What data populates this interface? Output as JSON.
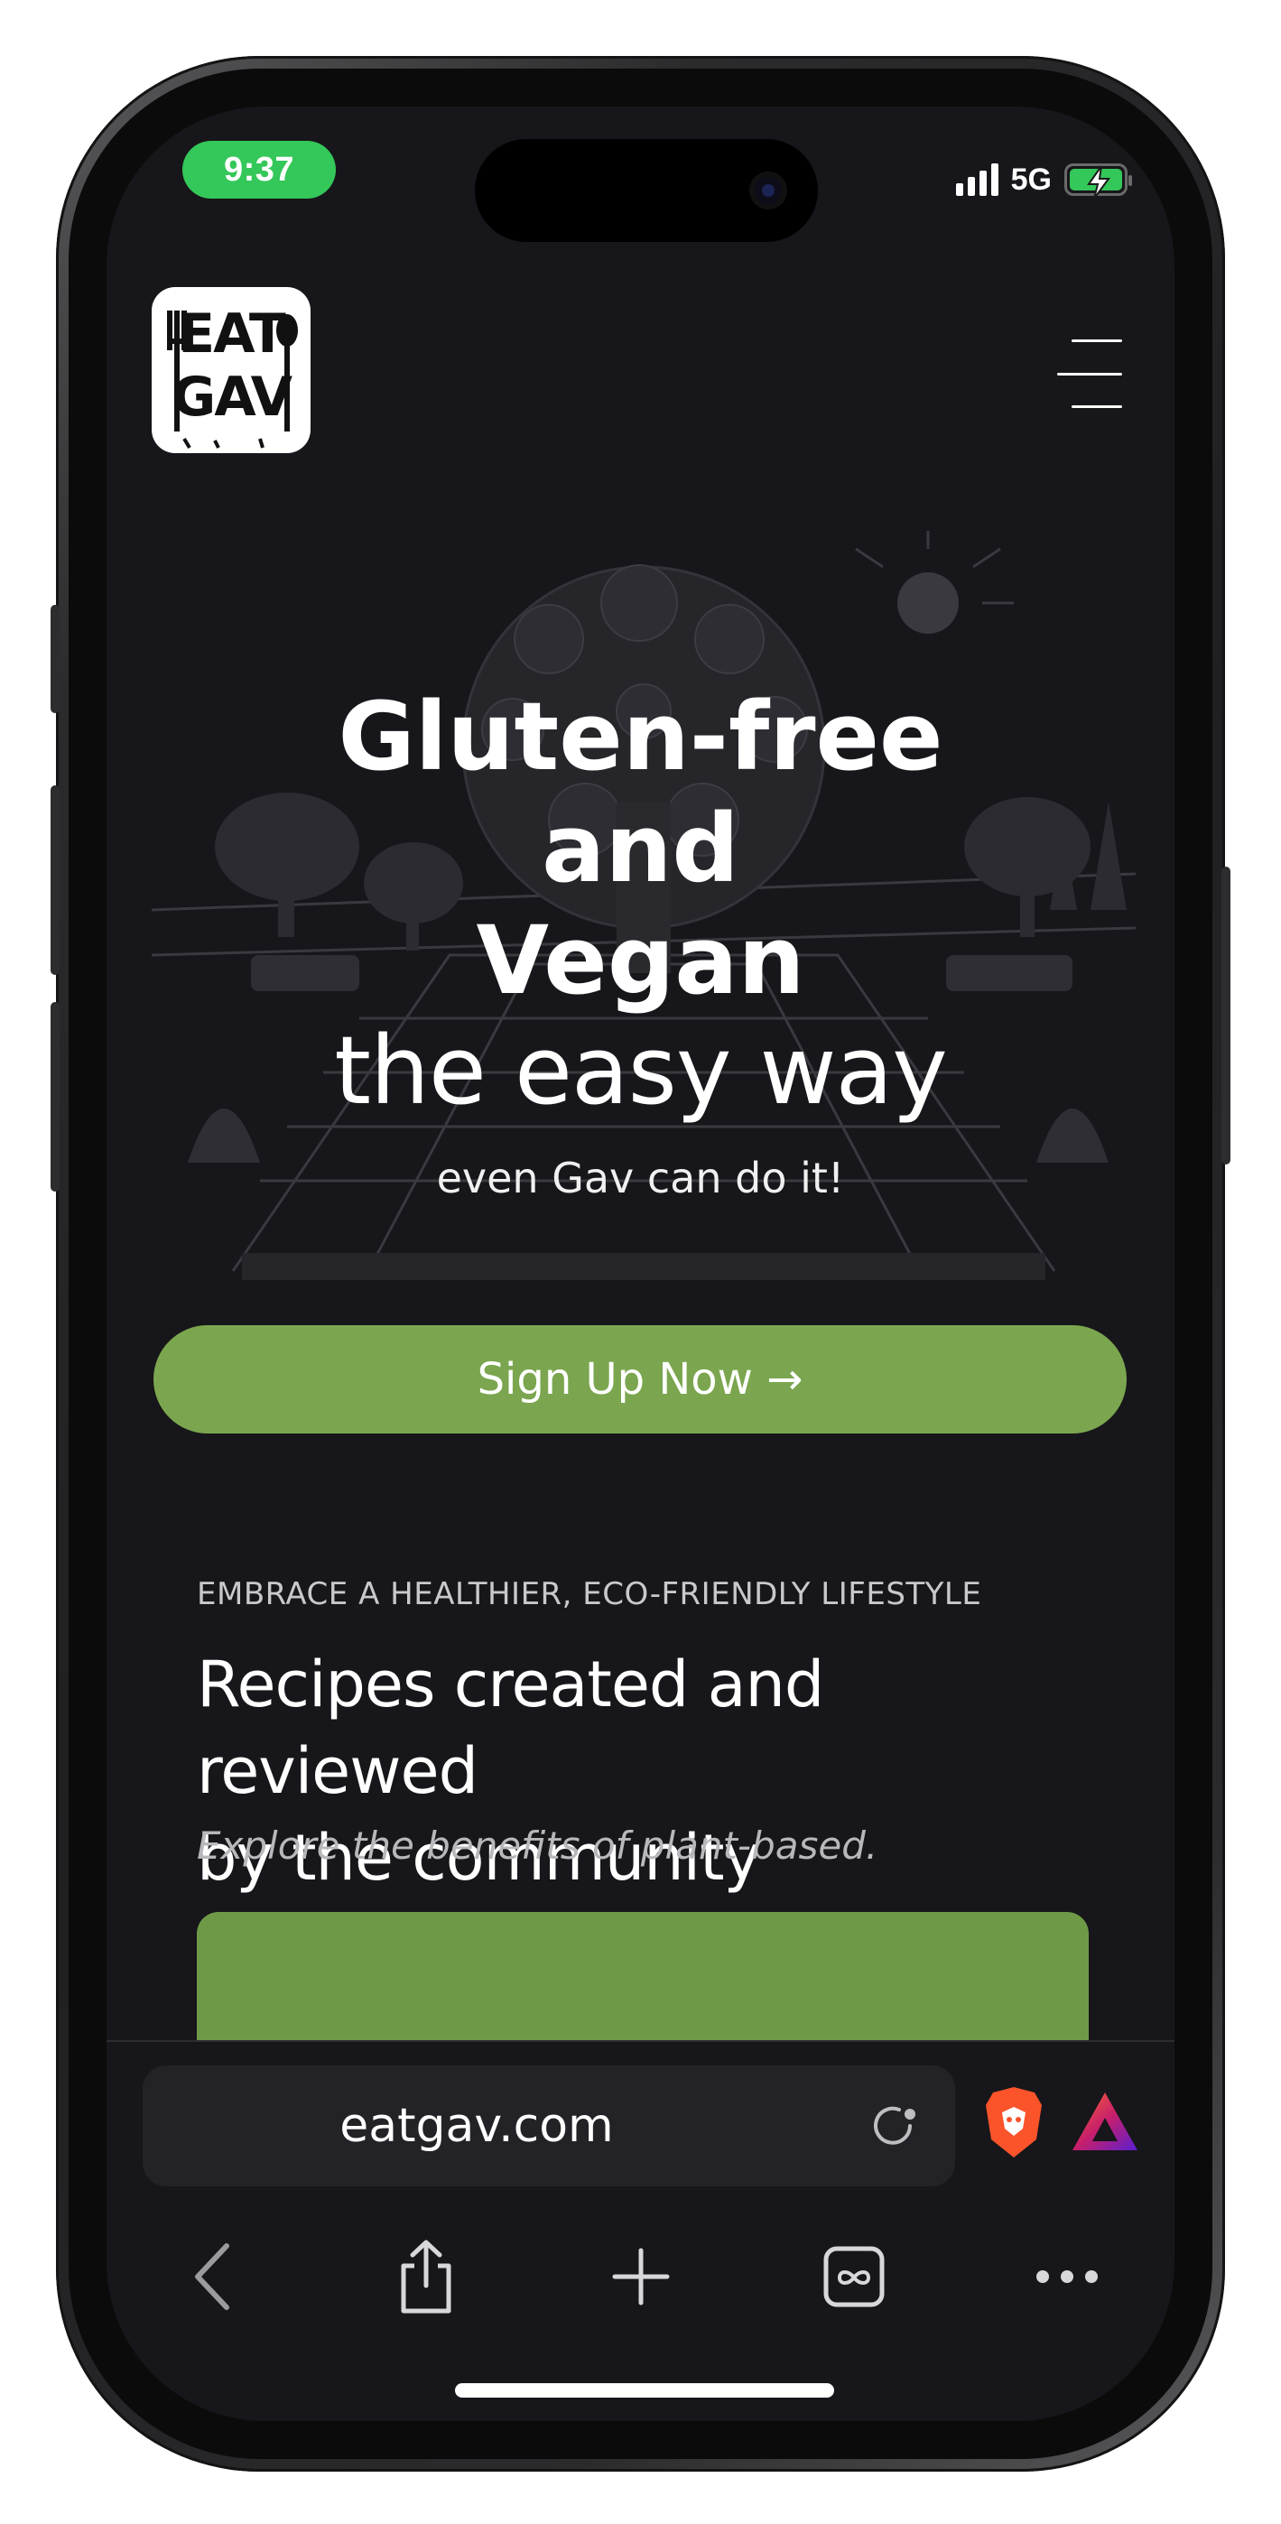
{
  "status_bar": {
    "time": "9:37",
    "network": "5G",
    "battery_state": "charging",
    "signal_bars": 4
  },
  "site": {
    "logo_lines": [
      "EAT",
      "GAV"
    ],
    "menu_icon": "hamburger-menu-icon"
  },
  "hero": {
    "title_line1": "Gluten-free",
    "title_line2": "and",
    "title_line3": "Vegan",
    "title_line4": "the easy way",
    "tagline": "even Gav can do it!",
    "cta_label": "Sign Up Now →"
  },
  "section": {
    "eyebrow": "EMBRACE A HEALTHIER, ECO-FRIENDLY LIFESTYLE",
    "headline_line1": "Recipes created and reviewed",
    "headline_line2": "by the community",
    "subline": "Explore the benefits of plant-based."
  },
  "browser": {
    "url": "eatgav.com",
    "icons": [
      "reload-icon",
      "brave-shield-icon",
      "brave-rewards-icon",
      "back-icon",
      "share-icon",
      "new-tab-icon",
      "tabs-icon",
      "more-icon"
    ]
  },
  "colors": {
    "background": "#17161a",
    "accent_green": "#7ba64f",
    "card_green": "#6e9a47",
    "status_green": "#34c759",
    "brave_orange": "#fb542b"
  }
}
